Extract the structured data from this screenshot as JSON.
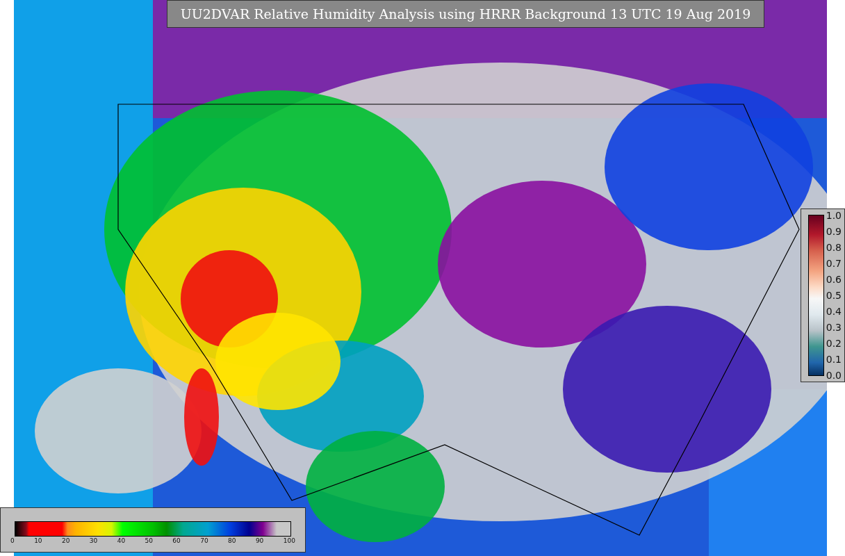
{
  "title": "UU2DVAR Relative Humidity Analysis using HRRR Background 13 UTC 19 Aug 2019",
  "colorbars": [
    {
      "kind": "vertical",
      "ticks": [
        "1.0",
        "0.9",
        "0.8",
        "0.7",
        "0.6",
        "0.5",
        "0.4",
        "0.3",
        "0.2",
        "0.1",
        "0.0"
      ]
    },
    {
      "kind": "horizontal",
      "ticks": [
        "0",
        "10",
        "20",
        "30",
        "40",
        "50",
        "60",
        "70",
        "80",
        "90",
        "100"
      ]
    }
  ]
}
